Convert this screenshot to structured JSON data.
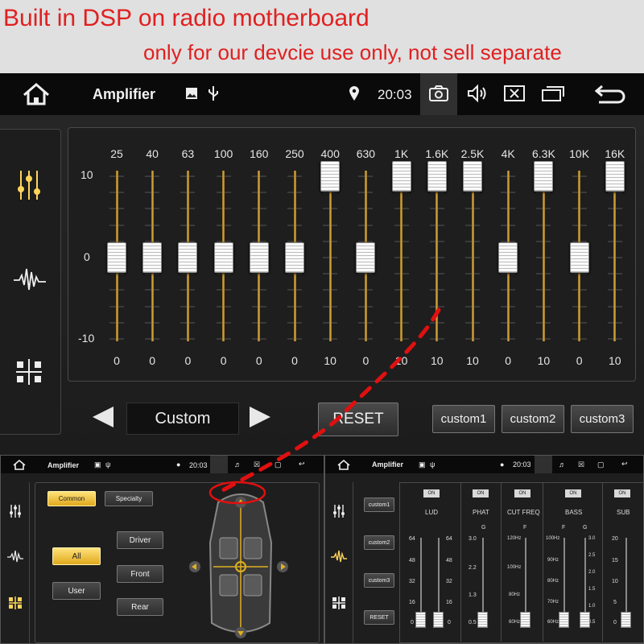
{
  "banner": {
    "line1": "Built in DSP on radio motherboard",
    "line2": "only for our devcie use only, not sell separate"
  },
  "topbar": {
    "title": "Amplifier",
    "time": "20:03"
  },
  "equalizer": {
    "scale": [
      "10",
      "0",
      "-10"
    ],
    "bands": [
      {
        "freq": "25",
        "value": "0"
      },
      {
        "freq": "40",
        "value": "0"
      },
      {
        "freq": "63",
        "value": "0"
      },
      {
        "freq": "100",
        "value": "0"
      },
      {
        "freq": "160",
        "value": "0"
      },
      {
        "freq": "250",
        "value": "0"
      },
      {
        "freq": "400",
        "value": "10"
      },
      {
        "freq": "630",
        "value": "0"
      },
      {
        "freq": "1K",
        "value": "10"
      },
      {
        "freq": "1.6K",
        "value": "10"
      },
      {
        "freq": "2.5K",
        "value": "10"
      },
      {
        "freq": "4K",
        "value": "0"
      },
      {
        "freq": "6.3K",
        "value": "10"
      },
      {
        "freq": "10K",
        "value": "0"
      },
      {
        "freq": "16K",
        "value": "10"
      }
    ]
  },
  "controls": {
    "preset": "Custom",
    "reset": "RESET",
    "custom1": "custom1",
    "custom2": "custom2",
    "custom3": "custom3"
  },
  "panel_left": {
    "title": "Amplifier",
    "time": "20:03",
    "tab_common": "Common",
    "tab_specialty": "Specialty",
    "all": "All",
    "user": "User",
    "driver": "Driver",
    "front": "Front",
    "rear": "Rear"
  },
  "panel_right": {
    "title": "Amplifier",
    "time": "20:03",
    "custom1": "custom1",
    "custom2": "custom2",
    "custom3": "custom3",
    "reset": "RESET",
    "on": "ON",
    "groups": [
      "LUD",
      "PHAT",
      "CUT FREQ",
      "BASS",
      "SUB"
    ],
    "lud_scale": [
      "64",
      "48",
      "32",
      "16",
      "0"
    ],
    "phat_scale": [
      "3.0",
      "2.2",
      "1.3",
      "0.5"
    ],
    "cut_scale": [
      "120Hz",
      "100Hz",
      "80Hz",
      "60Hz"
    ],
    "bass_scale": [
      "100Hz",
      "90Hz",
      "80Hz",
      "70Hz",
      "60Hz"
    ],
    "bass_scale2": [
      "3.0",
      "2.5",
      "2.0",
      "1.5",
      "1.0",
      "0.5"
    ],
    "sub_scale": [
      "20",
      "15",
      "10",
      "5",
      "0"
    ],
    "letter_f": "F",
    "letter_g": "G"
  },
  "colors": {
    "banner_text": "#e02020",
    "accent_gold": "#e0a81c",
    "path_red": "#e01010"
  }
}
